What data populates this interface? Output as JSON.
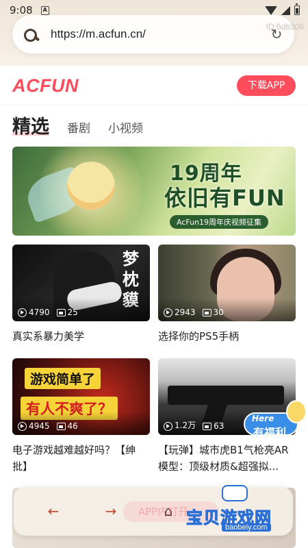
{
  "status_bar": {
    "time": "9:08",
    "sim_letter": "A"
  },
  "browser": {
    "url": "https://m.acfun.cn/",
    "id_tag": "ID:6db306"
  },
  "header": {
    "logo": "ACFUN",
    "download_label": "下载APP"
  },
  "tabs": [
    {
      "label": "精选",
      "active": true
    },
    {
      "label": "番剧",
      "active": false
    },
    {
      "label": "小视频",
      "active": false
    }
  ],
  "banner": {
    "headline": "19周年",
    "subline": "依旧有FUN",
    "pill": "AcFun19周年庆视频征集"
  },
  "videos": [
    {
      "views": "4790",
      "comments": "25",
      "title": "真实系暴力美学",
      "overlay": "梦枕貘"
    },
    {
      "views": "2943",
      "comments": "30",
      "title": "选择你的PS5手柄"
    },
    {
      "views": "4945",
      "comments": "46",
      "title": "电子游戏越难越好吗？【绅批】",
      "overlay_1": "游戏简单了",
      "overlay_2": "有人不爽了？"
    },
    {
      "views": "1.2万",
      "comments": "63",
      "title": "【玩弹】城市虎B1气枪亮AR模型：顶级材质&超强拟..."
    }
  ],
  "bottom_nav": {
    "back": "←",
    "forward": "→",
    "home": "⌂",
    "ghost_label": "APP内打开"
  },
  "promo": {
    "here": "Here",
    "label": "有福利"
  },
  "watermark": {
    "cn": "宝贝游戏网",
    "en": "baobeiy.com"
  },
  "colors": {
    "accent": "#fd4c5c",
    "watermark_blue": "#2a6fd6"
  }
}
